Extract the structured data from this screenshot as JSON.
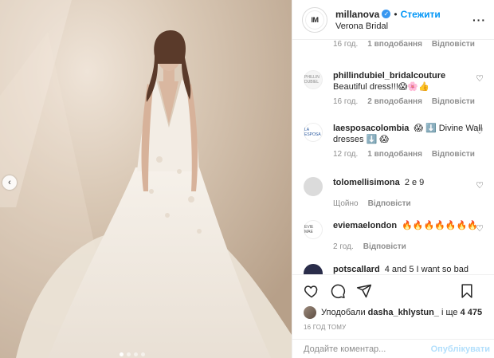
{
  "photo": {
    "carousel_dots": 4,
    "active_dot": 1,
    "prev_icon": "chevron-left-icon"
  },
  "header": {
    "avatar_text": "IM",
    "username": "millanova",
    "separator": "•",
    "follow_label": "Стежити",
    "location": "Verona Bridal",
    "more_icon": "ellipsis-icon"
  },
  "comments": [
    {
      "user": "",
      "text": "",
      "time": "16 год.",
      "likes": "1 вподобання",
      "reply": "Відповісти",
      "avatar": "verona-avatar"
    },
    {
      "user": "phillindubiel_bridalcouture",
      "text": "Beautiful dress!!!😱🌸👍",
      "time": "16 год.",
      "likes": "2 вподобання",
      "reply": "Відповісти",
      "avatar_text": "PHILLIN DUBIEL"
    },
    {
      "user": "laesposacolombia",
      "text": "😱 ⬇️ Divine Wall dresses ⬇️ 😱",
      "time": "12 год.",
      "likes": "1 вподобання",
      "reply": "Відповісти",
      "avatar_text": "LA ESPOSA"
    },
    {
      "user": "tolomellisimona",
      "text": "2 e 9",
      "time": "Щойно",
      "likes": "",
      "reply": "Відповісти",
      "avatar_text": ""
    },
    {
      "user": "eviemaelondon",
      "text": "🔥🔥🔥🔥🔥🔥🔥",
      "time": "2 год.",
      "likes": "",
      "reply": "Відповісти",
      "avatar_text": "EVIE MAE"
    },
    {
      "user": "potscallard",
      "text": "4 and 5 I want so bad",
      "time": "",
      "likes": "",
      "reply": "",
      "avatar_text": ""
    }
  ],
  "actions": {
    "like_icon": "heart-icon",
    "comment_icon": "comment-icon",
    "share_icon": "paper-plane-icon",
    "save_icon": "bookmark-icon"
  },
  "likes": {
    "prefix": "Уподобали",
    "user": "dasha_khlystun_",
    "middle": "і ще",
    "count": "4 475"
  },
  "post_time": "16 год тому",
  "add_comment": {
    "placeholder": "Додайте коментар...",
    "publish_label": "Опублікувати"
  }
}
